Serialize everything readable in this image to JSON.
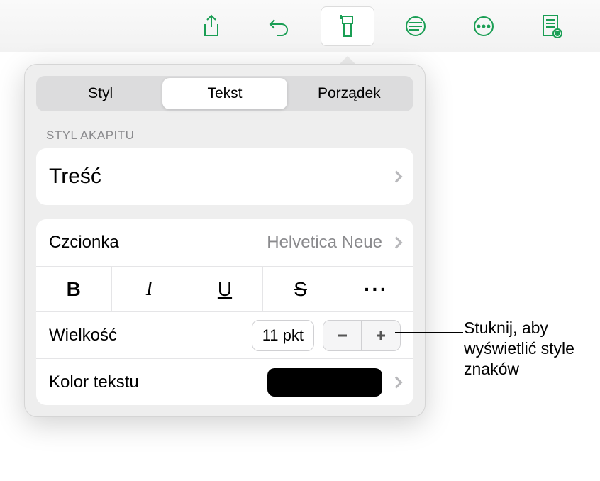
{
  "toolbar": {
    "share": "share",
    "undo": "undo",
    "format": "format-brush",
    "insert": "insert",
    "more": "more",
    "view": "view-options"
  },
  "tabs": {
    "style": "Styl",
    "text": "Tekst",
    "arrange": "Porządek"
  },
  "paragraph": {
    "header": "STYL AKAPITU",
    "style": "Treść"
  },
  "font": {
    "label": "Czcionka",
    "name": "Helvetica Neue",
    "formats": {
      "bold": "B",
      "italic": "I",
      "underline": "U",
      "strike": "S",
      "more": "···"
    }
  },
  "size": {
    "label": "Wielkość",
    "value": "11 pkt"
  },
  "color": {
    "label": "Kolor tekstu",
    "value": "#000000"
  },
  "callout": "Stuknij, aby wyświetlić style znaków"
}
